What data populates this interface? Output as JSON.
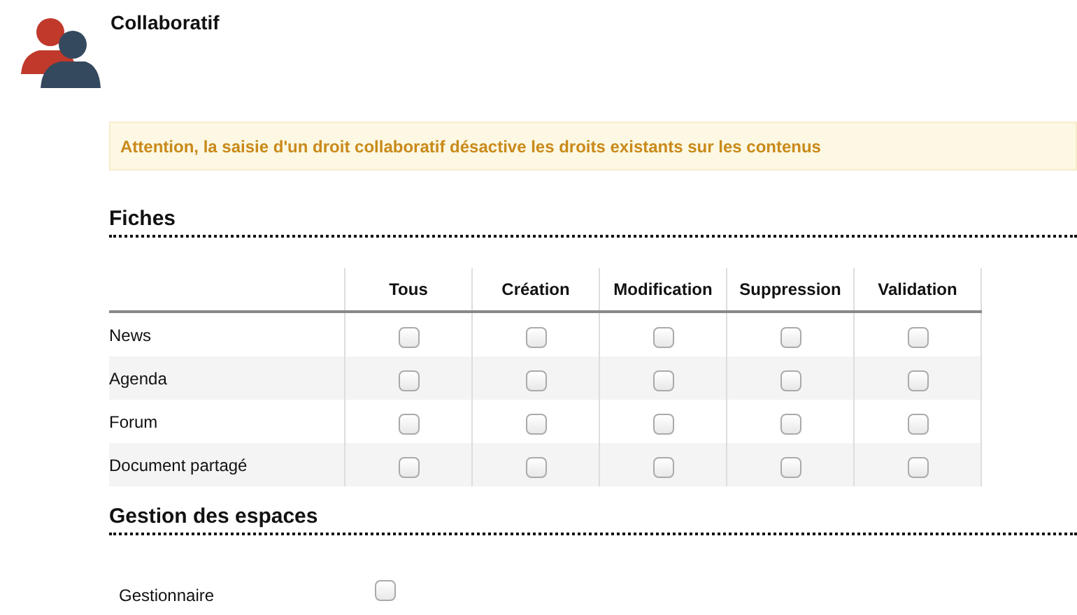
{
  "title": "Collaboratif",
  "alert": "Attention, la saisie d'un droit collaboratif désactive les droits existants sur les contenus",
  "fiches": {
    "heading": "Fiches",
    "columns": [
      "Tous",
      "Création",
      "Modification",
      "Suppression",
      "Validation"
    ],
    "rows": [
      {
        "label": "News",
        "checks": [
          false,
          false,
          false,
          false,
          false
        ]
      },
      {
        "label": "Agenda",
        "checks": [
          false,
          false,
          false,
          false,
          false
        ]
      },
      {
        "label": "Forum",
        "checks": [
          false,
          false,
          false,
          false,
          false
        ]
      },
      {
        "label": "Document partagé",
        "checks": [
          false,
          false,
          false,
          false,
          false
        ]
      }
    ]
  },
  "espaces": {
    "heading": "Gestion des espaces",
    "items": [
      {
        "label": "Gestionnaire",
        "checked": false
      }
    ]
  }
}
